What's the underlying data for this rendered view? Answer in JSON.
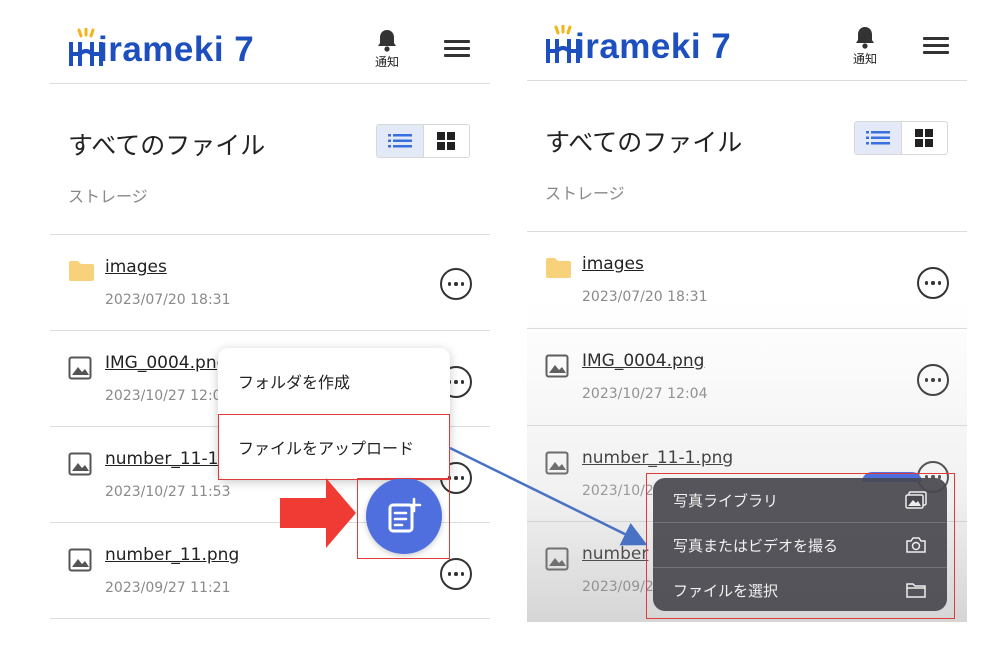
{
  "app": {
    "logo_text": "irameki 7",
    "notify_label": "通知"
  },
  "page": {
    "title": "すべてのファイル",
    "subtitle": "ストレージ"
  },
  "files": [
    {
      "name": "images",
      "date": "2023/07/20 18:31",
      "type": "folder"
    },
    {
      "name": "IMG_0004.png",
      "date": "2023/10/27 12:04",
      "type": "image"
    },
    {
      "name": "number_11-1.png",
      "date": "2023/10/27 11:53",
      "type": "image"
    },
    {
      "name": "number_11.png",
      "date": "2023/09/27 11:21",
      "type": "image"
    }
  ],
  "left_visible": {
    "file2_name": "IMG_0004.png",
    "file2_date": "2023/10/27 12:0",
    "file3_name": "number_11-1.",
    "file3_date": "2023/10/27 11:53"
  },
  "right_visible": {
    "file3_date": "2023/10/2",
    "file4_name": "number",
    "file4_date": "2023/09/2"
  },
  "upload_menu": {
    "create_folder": "フォルダを作成",
    "upload_file": "ファイルをアップロード"
  },
  "source_sheet": {
    "photo_library": "写真ライブラリ",
    "take_photo": "写真またはビデオを撮る",
    "choose_file": "ファイルを選択"
  },
  "colors": {
    "brand": "#1d4fbf",
    "fab": "#4f6fdf",
    "highlight": "#e03a3a",
    "arrow": "#ef3b33",
    "connector": "#4a72c4"
  },
  "icons": [
    "bell-icon",
    "menu-icon",
    "list-view-icon",
    "grid-view-icon",
    "folder-icon",
    "image-file-icon",
    "more-icon",
    "upload-file-icon",
    "photo-library-icon",
    "camera-icon",
    "folder-outline-icon"
  ]
}
